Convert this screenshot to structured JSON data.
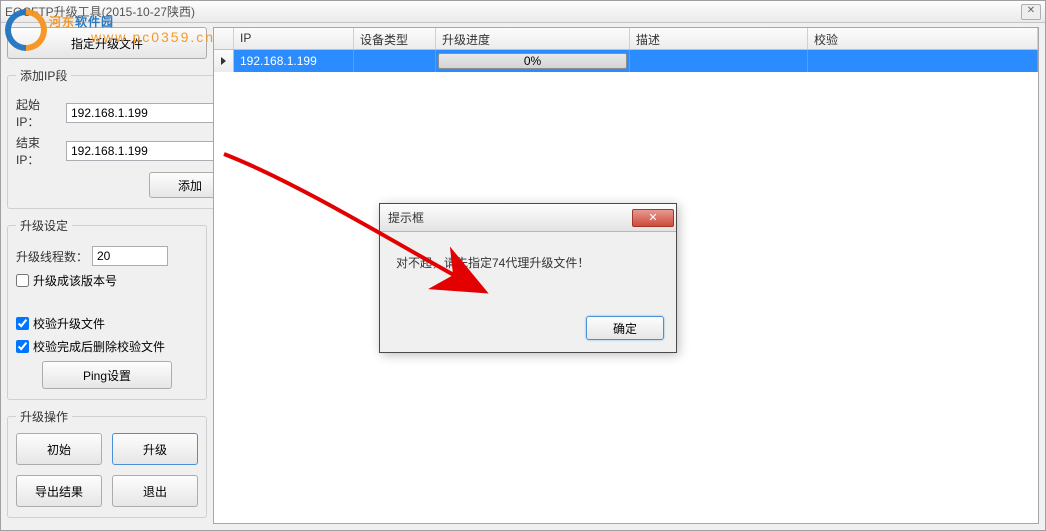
{
  "window": {
    "title": "EOCFTP升级工具(2015-10-27陕西)"
  },
  "sidebar": {
    "select_file_btn": "指定升级文件",
    "ip_section": {
      "legend": "添加IP段",
      "start_label": "起始IP：",
      "start_value": "192.168.1.199",
      "end_label": "结束IP：",
      "end_value": "192.168.1.199",
      "add_btn": "添加"
    },
    "upgrade_setting": {
      "legend": "升级设定",
      "threads_label": "升级线程数：",
      "threads_value": "20",
      "version_chk": "升级成该版本号",
      "verify_chk": "校验升级文件",
      "del_verify_chk": "校验完成后删除校验文件",
      "ping_btn": "Ping设置"
    },
    "upgrade_ops": {
      "legend": "升级操作",
      "init_btn": "初始",
      "upgrade_btn": "升级",
      "export_btn": "导出结果",
      "exit_btn": "退出"
    }
  },
  "table": {
    "headers": {
      "ip": "IP",
      "device": "设备类型",
      "progress": "升级进度",
      "desc": "描述",
      "check": "校验"
    },
    "rows": [
      {
        "ip": "192.168.1.199",
        "device": "",
        "progress": "0%",
        "desc": "",
        "check": ""
      }
    ]
  },
  "dialog": {
    "title": "提示框",
    "message": "对不起，请先指定74代理升级文件！",
    "ok": "确定"
  },
  "watermark": {
    "text1": "河东",
    "text2": "软件园",
    "url": "www.pc0359.cn"
  }
}
